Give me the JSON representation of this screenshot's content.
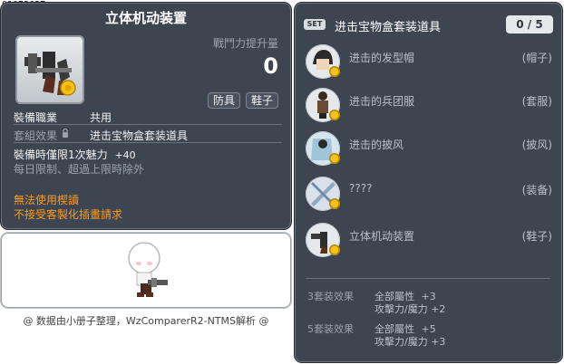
{
  "item_id": "01073027",
  "item": {
    "title": "立体机动装置",
    "power_label": "戰鬥力提升量",
    "power_value": "0",
    "tags": [
      "防具",
      "鞋子"
    ],
    "job_label": "裝備職業",
    "job_value": "共用",
    "set_label": "套組效果",
    "set_value": "进击宝物盒套装道具",
    "charm_line": "裝備時僅限1次魅力",
    "charm_value": "+40",
    "limit_note": "每日限制、超過上限時除外",
    "warn_1": "無法使用楔讀",
    "warn_2": "不接受客製化插畫請求"
  },
  "credit": "@ 数据由小册子整理，WzComparerR2-NTMS解析 @",
  "set_panel": {
    "badge": "SET",
    "title": "进击宝物盒套装道具",
    "count": "0 / 5",
    "items": [
      {
        "name": "进击的发型帽",
        "type": "(帽子)",
        "icon": "hat-icon"
      },
      {
        "name": "进击的兵团服",
        "type": "(套服)",
        "icon": "uniform-icon"
      },
      {
        "name": "进击的披风",
        "type": "(披风)",
        "icon": "cape-icon"
      },
      {
        "name": "????",
        "type": "(装备)",
        "icon": "blades-icon"
      },
      {
        "name": "立体机动装置",
        "type": "(鞋子)",
        "icon": "gear-icon"
      }
    ],
    "effects": [
      {
        "label": "3套装效果",
        "line1": "全部屬性",
        "line1_val": "+3",
        "line2": "攻擊力/魔力",
        "line2_val": "+2"
      },
      {
        "label": "5套装效果",
        "line1": "全部屬性",
        "line1_val": "+5",
        "line2": "攻擊力/魔力",
        "line2_val": "+3"
      }
    ]
  },
  "colors": {
    "panel_bg": "#3d4550",
    "warning": "#ff9a1a",
    "muted": "#9aa3ad"
  }
}
